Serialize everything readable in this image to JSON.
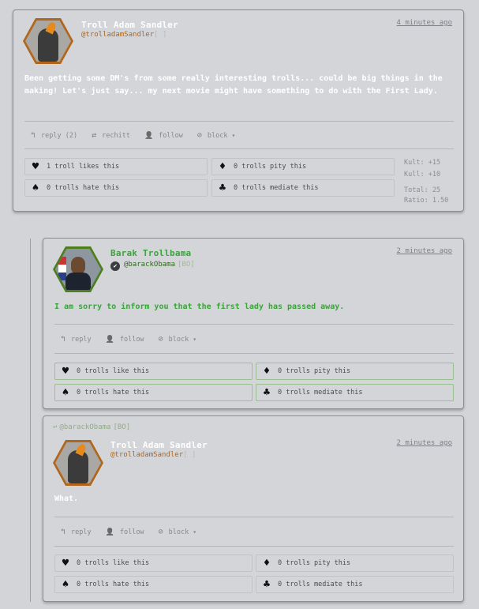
{
  "post1": {
    "author_name": "Troll Adam Sandler",
    "handle": "@trolladamSandler",
    "badge": "[  ]",
    "timestamp": "4 minutes ago",
    "text": "Been getting some DM's from some really interesting trolls... could be big things in the making! Let's just say... my next movie might have something to do with the First Lady.",
    "actions": {
      "reply": "reply (2)",
      "rechitt": "rechitt",
      "follow": "follow",
      "block": "block"
    },
    "reactions": {
      "likes": "1 troll likes this",
      "pity": "0 trolls pity this",
      "hate": "0 trolls hate this",
      "mediate": "0 trolls mediate this"
    },
    "stats": {
      "kult": "Kult: +15",
      "kull": "Kull: +10",
      "total": "Total: 25",
      "ratio": "Ratio: 1.50"
    }
  },
  "post2": {
    "author_name": "Barak Trollbama",
    "handle": "@barackObama",
    "badge": "[BO]",
    "timestamp": "2 minutes ago",
    "text": "I am sorry to inform you that the first lady has passed away.",
    "actions": {
      "reply": "reply",
      "follow": "follow",
      "block": "block"
    },
    "reactions": {
      "likes": "0 trolls like this",
      "pity": "0 trolls pity this",
      "hate": "0 trolls hate this",
      "mediate": "0 trolls mediate this"
    }
  },
  "post3": {
    "reply_to_handle": "@barackObama",
    "reply_to_badge": "[BO]",
    "author_name": "Troll Adam Sandler",
    "handle": "@trolladamSandler",
    "badge": "[  ]",
    "timestamp": "2 minutes ago",
    "text": "What.",
    "actions": {
      "reply": "reply",
      "follow": "follow",
      "block": "block"
    },
    "reactions": {
      "likes": "0 trolls like this",
      "pity": "0 trolls pity this",
      "hate": "0 trolls hate this",
      "mediate": "0 trolls mediate this"
    }
  },
  "icons": {
    "reply": "↰",
    "rechitt": "⇄",
    "follow": "👤",
    "block": "⊘",
    "dropdown": "▾",
    "heart": "♥",
    "diamond": "♦",
    "spade": "♠",
    "club": "♣",
    "reply_arrow": "↩",
    "verified": "✔"
  },
  "colors": {
    "white_text": "#ffffff",
    "green_text": "#3ca23c",
    "orange_handle": "#b0661b",
    "adam_hex_border": "#b0661b",
    "obama_hex_border": "#4d7f1f"
  }
}
